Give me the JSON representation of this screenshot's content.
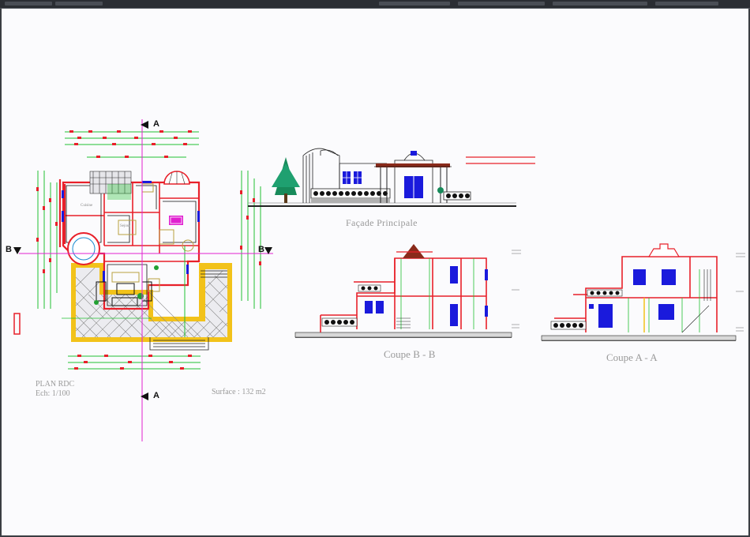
{
  "window": {
    "app": "CAD drawing viewer"
  },
  "drawing": {
    "facade_title": "Façade Principale",
    "coupe_bb_title": "Coupe  B - B",
    "coupe_aa_title": "Coupe  A - A",
    "plan_title": "PLAN RDC",
    "plan_scale": "Ech: 1/100",
    "surface": "Surface : 132 m2",
    "section_mark_a": "A",
    "section_mark_b": "B",
    "room_labels": [
      "Cuisine",
      "Sejour"
    ]
  },
  "colors": {
    "background": "#fbfbfd",
    "wall_red": "#e8202a",
    "green_dim": "#22c032",
    "magenta_axis": "#e020d0",
    "blue_window": "#1a1adc",
    "yellow_terrace": "#f2c21a",
    "label_grey": "#9a9a9a"
  }
}
